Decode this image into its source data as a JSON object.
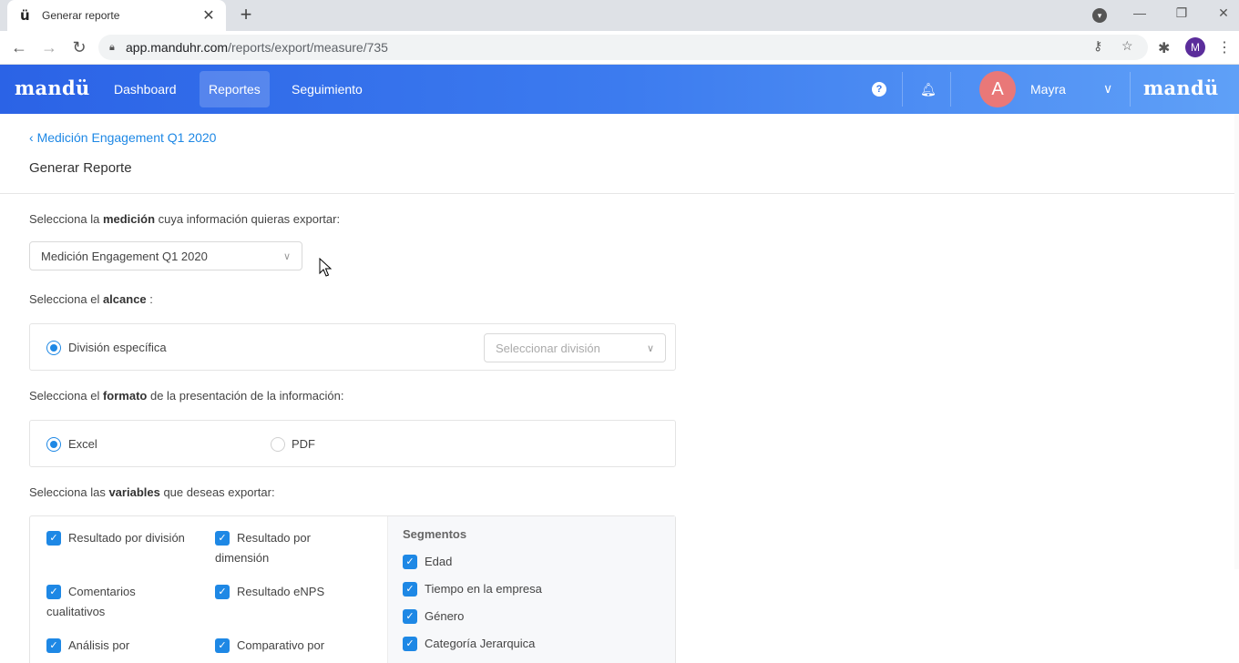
{
  "browser": {
    "tab_title": "Generar reporte",
    "favicon": "ü",
    "url_host": "app.manduhr.com",
    "url_path": "/reports/export/measure/735",
    "profile_initial": "M"
  },
  "header": {
    "logo": "mandü",
    "nav": [
      "Dashboard",
      "Reportes",
      "Seguimiento"
    ],
    "active_nav": "Reportes",
    "avatar_initial": "A",
    "user_name": "Mayra",
    "brand_logo": "mandü",
    "accent_color": "#2b63e6"
  },
  "page": {
    "back_link": "Medición Engagement Q1 2020",
    "title": "Generar Reporte"
  },
  "measure": {
    "label_prefix": "Selecciona la",
    "label_bold": "medición",
    "label_suffix": "cuya información quieras exportar:",
    "selected": "Medición Engagement Q1 2020"
  },
  "scope": {
    "label_prefix": "Selecciona el",
    "label_bold": "alcance",
    "label_suffix": ":",
    "option": "División específica",
    "division_placeholder": "Seleccionar división"
  },
  "format": {
    "label_prefix": "Selecciona el",
    "label_bold": "formato",
    "label_suffix": "de la presentación de la información:",
    "options": [
      "Excel",
      "PDF"
    ],
    "selected": "Excel"
  },
  "variables": {
    "label_prefix": "Selecciona las",
    "label_bold": "variables",
    "label_suffix": "que deseas exportar:",
    "items": [
      {
        "line1": "Resultado por división",
        "line2": ""
      },
      {
        "line1": "Resultado por",
        "line2": "dimensión"
      },
      {
        "line1": " Comentarios",
        "line2": "cualitativos"
      },
      {
        "line1": "Resultado eNPS",
        "line2": ""
      },
      {
        "line1": "Análisis por",
        "line2": ""
      },
      {
        "line1": "Comparativo por",
        "line2": ""
      }
    ],
    "segments_title": "Segmentos",
    "segments": [
      "Edad",
      "Tiempo en la empresa",
      "Género",
      "Categoría Jerarquica"
    ]
  }
}
